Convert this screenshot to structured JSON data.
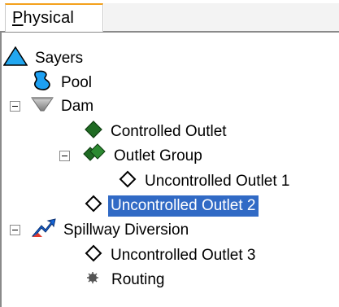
{
  "tab": {
    "label_prefix": "P",
    "label_rest": "hysical"
  },
  "tree": {
    "nodes": [
      {
        "label": "Sayers"
      },
      {
        "label": "Pool"
      },
      {
        "label": "Dam"
      },
      {
        "label": "Controlled Outlet"
      },
      {
        "label": "Outlet Group"
      },
      {
        "label": "Uncontrolled Outlet 1"
      },
      {
        "label": "Uncontrolled Outlet 2",
        "selected": true
      },
      {
        "label": "Spillway Diversion"
      },
      {
        "label": "Uncontrolled Outlet 3"
      },
      {
        "label": "Routing"
      }
    ]
  },
  "colors": {
    "selection": "#316ac5",
    "tab_accent": "#f4a11c"
  }
}
